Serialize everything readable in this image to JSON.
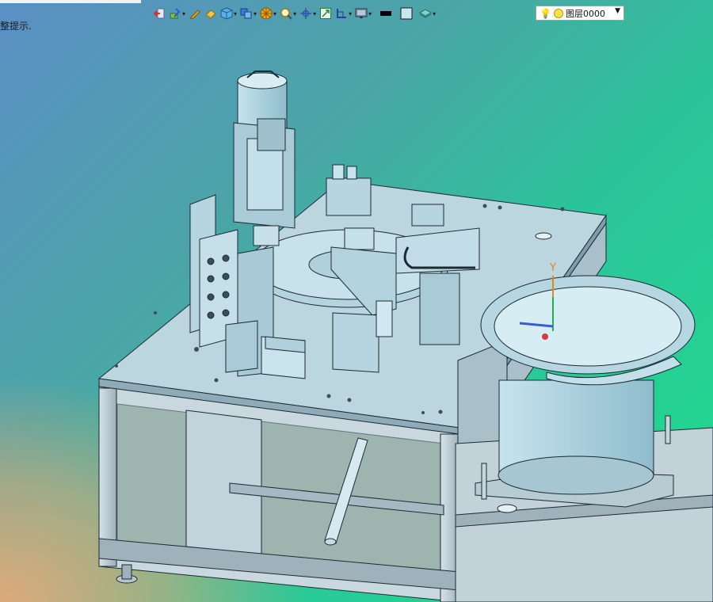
{
  "app": {
    "status_hint": "完整提示.",
    "hint_visible_part": "整提示."
  },
  "toolbar": {
    "items": [
      {
        "name": "exit-sketch-icon"
      },
      {
        "name": "sketch-tools-icon",
        "dropdown": true
      },
      {
        "name": "pen-icon"
      },
      {
        "name": "eraser-icon"
      },
      {
        "name": "solid-cube-icon",
        "dropdown": true
      },
      {
        "name": "copy-view-icon",
        "dropdown": true
      },
      {
        "name": "render-mode-icon",
        "dropdown": true
      },
      {
        "name": "zoom-icon",
        "dropdown": true
      },
      {
        "name": "pan-icon",
        "dropdown": true
      },
      {
        "name": "fit-view-icon"
      },
      {
        "name": "section-view-icon",
        "dropdown": true
      },
      {
        "name": "monitor-view-icon",
        "dropdown": true
      },
      {
        "name": "line-color-swatch"
      },
      {
        "name": "fill-color-swatch"
      },
      {
        "name": "layer-stack-icon",
        "dropdown": true
      }
    ],
    "layer_select": {
      "value": "图层0000"
    }
  },
  "model": {
    "axis_label": "Y",
    "colors": {
      "body": "#b9d9e6",
      "edge": "#1b2a33",
      "frame": "#c7d6dd"
    }
  }
}
